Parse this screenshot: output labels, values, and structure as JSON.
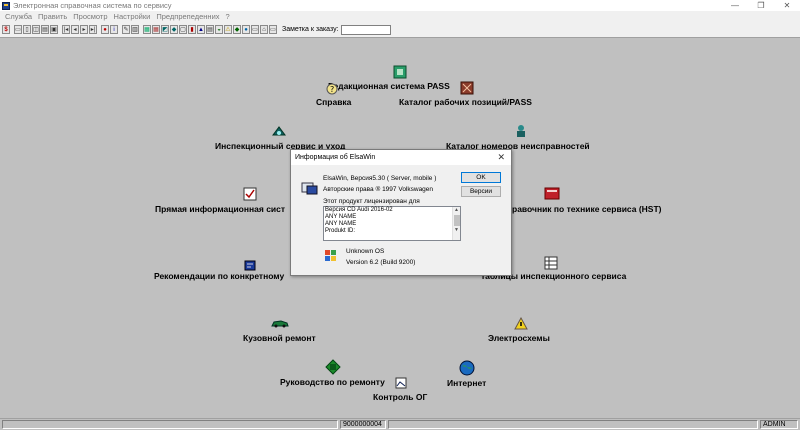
{
  "window": {
    "title": "Электронная справочная система по сервису",
    "controls": {
      "minimize": "—",
      "restore": "❐",
      "close": "✕"
    }
  },
  "menu": [
    "Служба",
    "Править",
    "Просмотр",
    "Настройки",
    "Предпрепеденних",
    "?"
  ],
  "toolbar": {
    "note_label": "Заметка к заказу:",
    "note_value": ""
  },
  "desktop_items": [
    {
      "key": "pass",
      "label": "Редакционная система PASS",
      "icon": "pass-icon"
    },
    {
      "key": "help",
      "label": "Справка",
      "icon": "help-icon"
    },
    {
      "key": "catalog",
      "label": "Каталог рабочих позиций/PASS",
      "icon": "catalog-icon"
    },
    {
      "key": "inspection",
      "label": "Инспекционный сервис и уход",
      "icon": "inspection-icon"
    },
    {
      "key": "faults",
      "label": "Каталог  номеров  неисправностей",
      "icon": "faults-icon"
    },
    {
      "key": "direct",
      "label": "Прямая информационная сист",
      "icon": "direct-icon"
    },
    {
      "key": "hst",
      "label": "равочник по технике сервиса (HST)",
      "icon": "hst-icon"
    },
    {
      "key": "recommend",
      "label": "Рекомендации по конкретному",
      "icon": "recommend-icon"
    },
    {
      "key": "tables",
      "label": "таблицы инспекционного сервиса",
      "icon": "tables-icon"
    },
    {
      "key": "body",
      "label": "Кузовной ремонт",
      "icon": "body-repair-icon"
    },
    {
      "key": "electro",
      "label": "Электросхемы",
      "icon": "electro-icon"
    },
    {
      "key": "manual",
      "label": "Руководство по ремонту",
      "icon": "manual-icon"
    },
    {
      "key": "internet",
      "label": "Интернет",
      "icon": "internet-icon"
    },
    {
      "key": "og",
      "label": "Контроль ОГ",
      "icon": "og-icon"
    }
  ],
  "dialog": {
    "title": "Информация об  ElsaWin",
    "close": "✕",
    "version": "ElsaWin, Версия5.30 ( Server, mobile )",
    "copyright": "Авторские права ® 1997 Volkswagen",
    "licensed_label": "Этот продукт лицензирован для",
    "license_lines": [
      "Версия CD  Audi 2016-02",
      "ANY NAME",
      "ANY NAME",
      "Produkt ID:"
    ],
    "os_name": "Unknown OS",
    "os_version": "Version 6.2 (Build 9200)",
    "ok_button": "OK",
    "versions_button": "Версии"
  },
  "status": {
    "code": "9000000004",
    "user": "ADMIN"
  },
  "colors": {
    "desktop": "#c0c0c0",
    "dialog": "#f0f0f0",
    "accent": "#0078d7"
  }
}
